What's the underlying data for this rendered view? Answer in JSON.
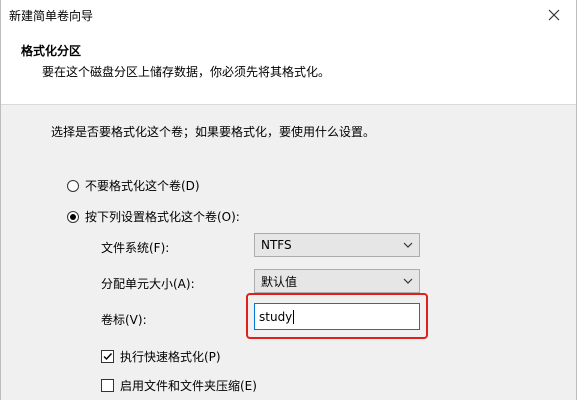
{
  "window": {
    "title": "新建简单卷向导"
  },
  "header": {
    "title": "格式化分区",
    "subtitle": "要在这个磁盘分区上储存数据，你必须先将其格式化。"
  },
  "body": {
    "prompt": "选择是否要格式化这个卷；如果要格式化，要使用什么设置。",
    "radio_no_format": "不要格式化这个卷(D)",
    "radio_format": "按下列设置格式化这个卷(O):",
    "filesystem_label": "文件系统(F):",
    "filesystem_value": "NTFS",
    "alloc_label": "分配单元大小(A):",
    "alloc_value": "默认值",
    "volume_label": "卷标(V):",
    "volume_value": "study",
    "quick_format": "执行快速格式化(P)",
    "compression": "启用文件和文件夹压缩(E)"
  },
  "colors": {
    "highlight": "#e0201c",
    "focus_border": "#0078d7"
  }
}
